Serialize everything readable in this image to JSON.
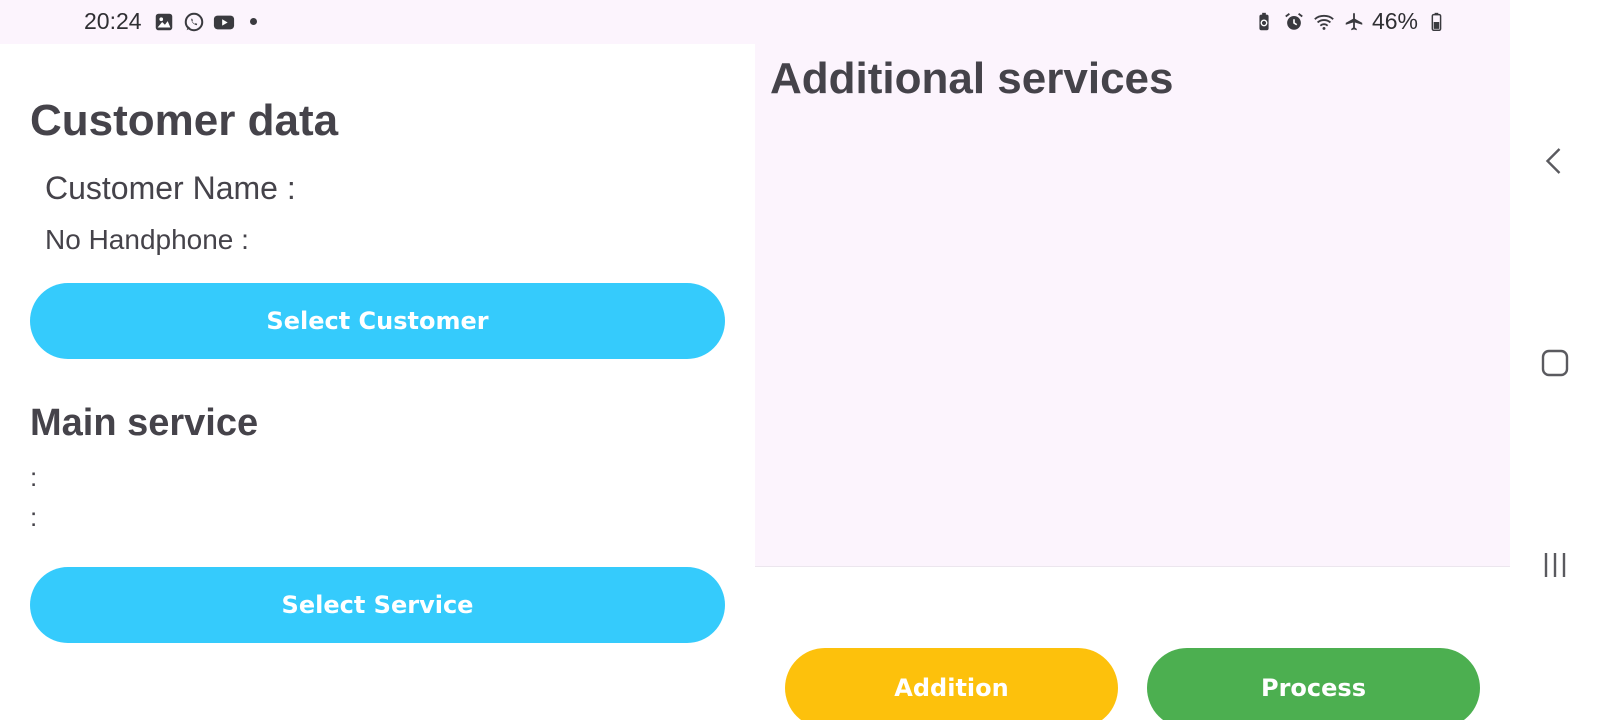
{
  "status_bar": {
    "time": "20:24",
    "left_icons": [
      "image-icon",
      "whatsapp-icon",
      "youtube-icon"
    ],
    "right_icons": [
      "battery-saver-icon",
      "alarm-icon",
      "wifi-icon",
      "airplane-icon"
    ],
    "battery_percent": "46%"
  },
  "customer": {
    "title": "Customer data",
    "name_label": "Customer Name :",
    "phone_label": "No Handphone :",
    "select_button": "Select Customer"
  },
  "main_service": {
    "title": "Main service",
    "line1": ":",
    "line2": ":",
    "select_button": "Select Service"
  },
  "additional_services": {
    "title": "Additional services",
    "items": []
  },
  "actions": {
    "addition_label": "Addition",
    "process_label": "Process"
  },
  "colors": {
    "select_button": "#35cbfc",
    "addition_button": "#fdc10c",
    "process_button": "#4caf50",
    "background": "#fcf4fd",
    "text": "#45434a"
  },
  "nav": {
    "icons": [
      "back-icon",
      "home-icon",
      "recent-apps-icon"
    ]
  }
}
